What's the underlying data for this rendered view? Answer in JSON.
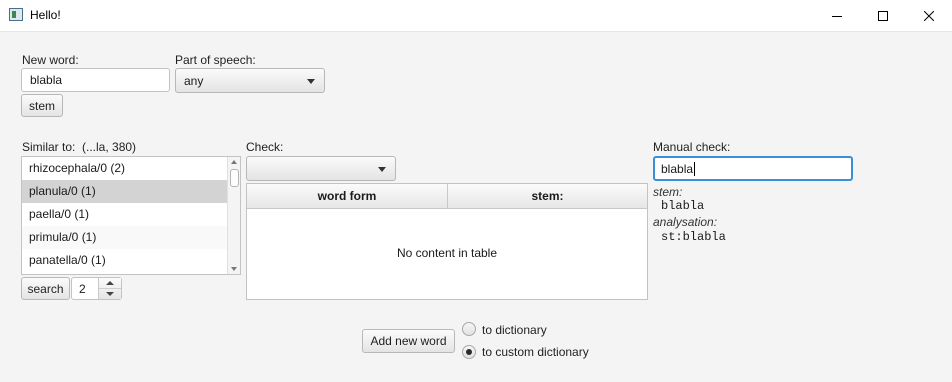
{
  "window": {
    "title": "Hello!"
  },
  "new_word": {
    "label": "New word:",
    "value": "blabla",
    "stem_button": "stem"
  },
  "part_of_speech": {
    "label": "Part of speech:",
    "selected": "any"
  },
  "similar": {
    "label": "Similar to:",
    "info": "(...la, 380)",
    "items": [
      "rhizocephala/0 (2)",
      "planula/0 (1)",
      "paella/0 (1)",
      "primula/0 (1)",
      "panatella/0 (1)"
    ],
    "selected_index": 1,
    "search_button": "search",
    "count": "2"
  },
  "check": {
    "label": "Check:",
    "selected": "",
    "table": {
      "columns": [
        "word form",
        "stem:"
      ],
      "empty_text": "No content in table"
    }
  },
  "manual_check": {
    "label": "Manual check:",
    "value": "blabla",
    "stem_label": "stem:",
    "stem_value": "blabla",
    "analysation_label": "analysation:",
    "analysation_value": "st:blabla"
  },
  "add": {
    "button": "Add new word",
    "options": [
      "to dictionary",
      "to custom dictionary"
    ],
    "selected_option": "to custom dictionary"
  },
  "colors": {
    "focus": "#3b8fd9",
    "selection": "#d3d3d3"
  }
}
